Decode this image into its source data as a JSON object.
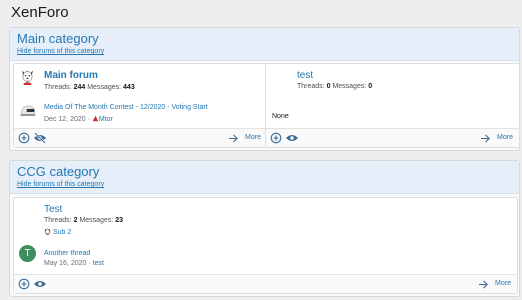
{
  "app": {
    "title": "XenForo"
  },
  "categories": [
    {
      "title": "Main category",
      "hide_link": "Hide forums of this category",
      "forums": [
        {
          "title": "Main forum",
          "threads_label": "Threads:",
          "threads": "244",
          "messages_label": "Messages:",
          "messages": "443",
          "last_post_title": "Media Of The Month Contest - 12/2020 - Voting Start",
          "last_post_date": "Dec 12, 2020",
          "sep": "·",
          "last_post_user": "Mtor",
          "more_label": "More"
        },
        {
          "title": "test",
          "threads_label": "Threads:",
          "threads": "0",
          "messages_label": "Messages:",
          "messages": "0",
          "last_post_none": "None",
          "more_label": "More"
        }
      ]
    },
    {
      "title": "CCG category",
      "hide_link": "Hide forums of this category",
      "forums": [
        {
          "title": "Test",
          "threads_label": "Threads:",
          "threads": "2",
          "messages_label": "Messages:",
          "messages": "23",
          "subforum": "Sub 2",
          "last_post_title": "Another thread",
          "last_post_date": "May 16, 2020",
          "sep": "·",
          "last_post_user": "test",
          "avatar_letter": "T",
          "more_label": "More"
        }
      ]
    }
  ],
  "icons": {
    "add": "plus-circle-icon",
    "watch_off": "eye-slash-icon",
    "watch": "eye-icon",
    "more": "arrow-right-icon"
  },
  "colors": {
    "link": "#2577b1",
    "header_bg": "#e6eff9",
    "avatar_green": "#3e8e5e"
  }
}
